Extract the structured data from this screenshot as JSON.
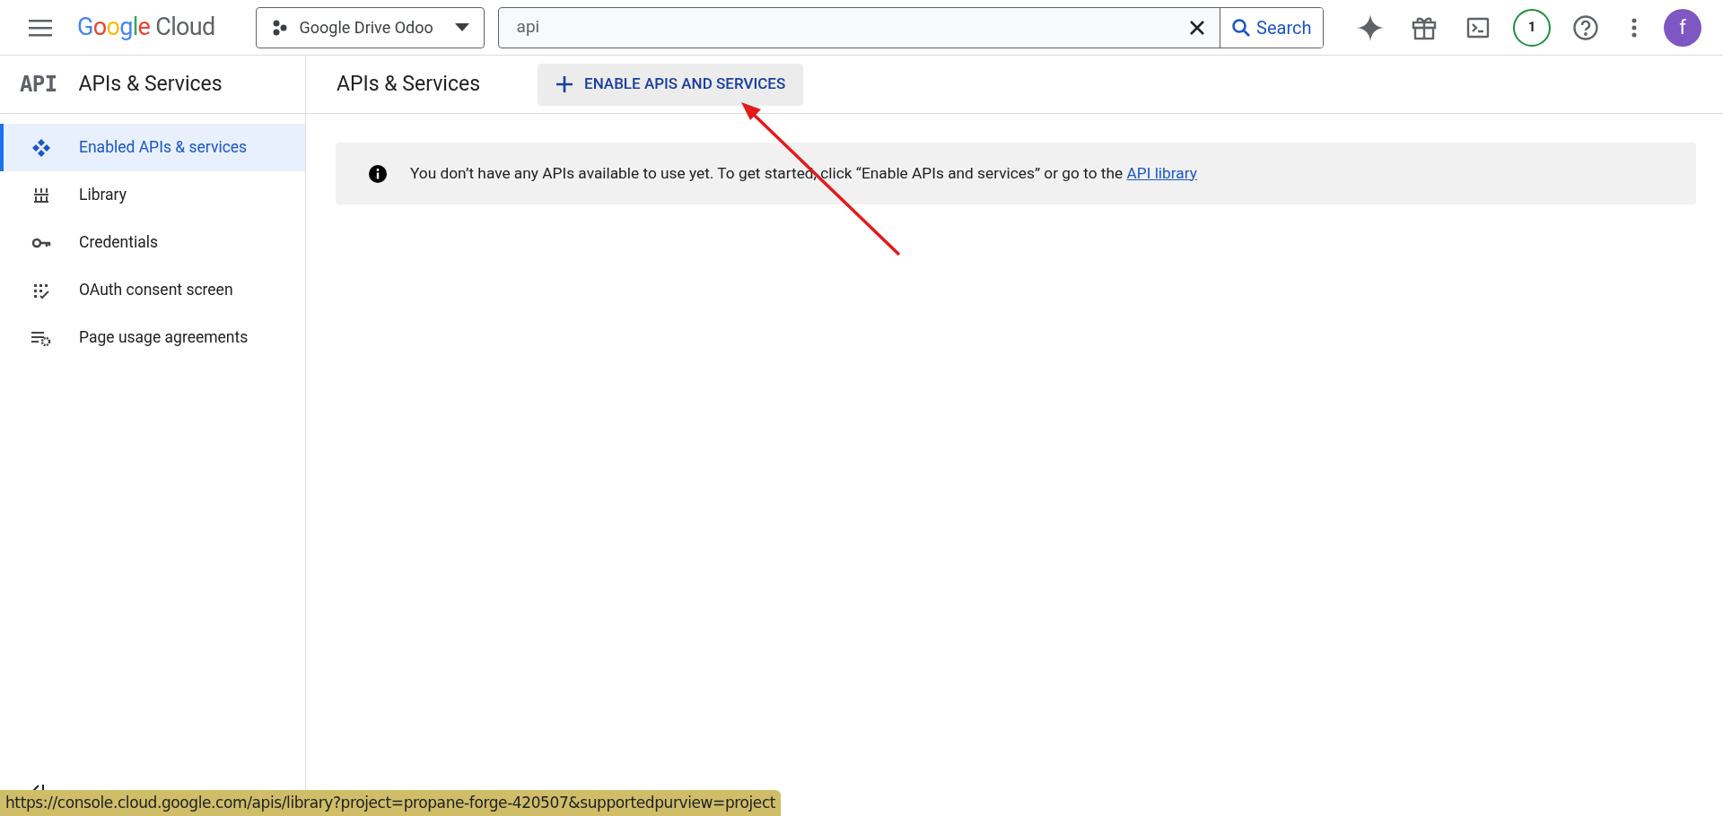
{
  "header": {
    "logo": {
      "brand": "Google",
      "product": "Cloud"
    },
    "project": "Google Drive Odoo",
    "search": {
      "value": "api",
      "button": "Search"
    },
    "notifications": "1",
    "avatar": "f"
  },
  "sidebar": {
    "badge": "API",
    "title": "APIs & Services",
    "items": [
      {
        "label": "Enabled APIs & services",
        "kind": "enabled",
        "selected": true
      },
      {
        "label": "Library",
        "kind": "library",
        "selected": false
      },
      {
        "label": "Credentials",
        "kind": "credentials",
        "selected": false
      },
      {
        "label": "OAuth consent screen",
        "kind": "oauth",
        "selected": false
      },
      {
        "label": "Page usage agreements",
        "kind": "agreements",
        "selected": false
      }
    ]
  },
  "main": {
    "title": "APIs & Services",
    "action": "ENABLE APIS AND SERVICES",
    "notice": {
      "text": "You don’t have any APIs available to use yet. To get started, click “Enable APIs and services” or go to the",
      "link": "API library"
    }
  },
  "status_url": "https://console.cloud.google.com/apis/library?project=propane-forge-420507&supportedpurview=project"
}
